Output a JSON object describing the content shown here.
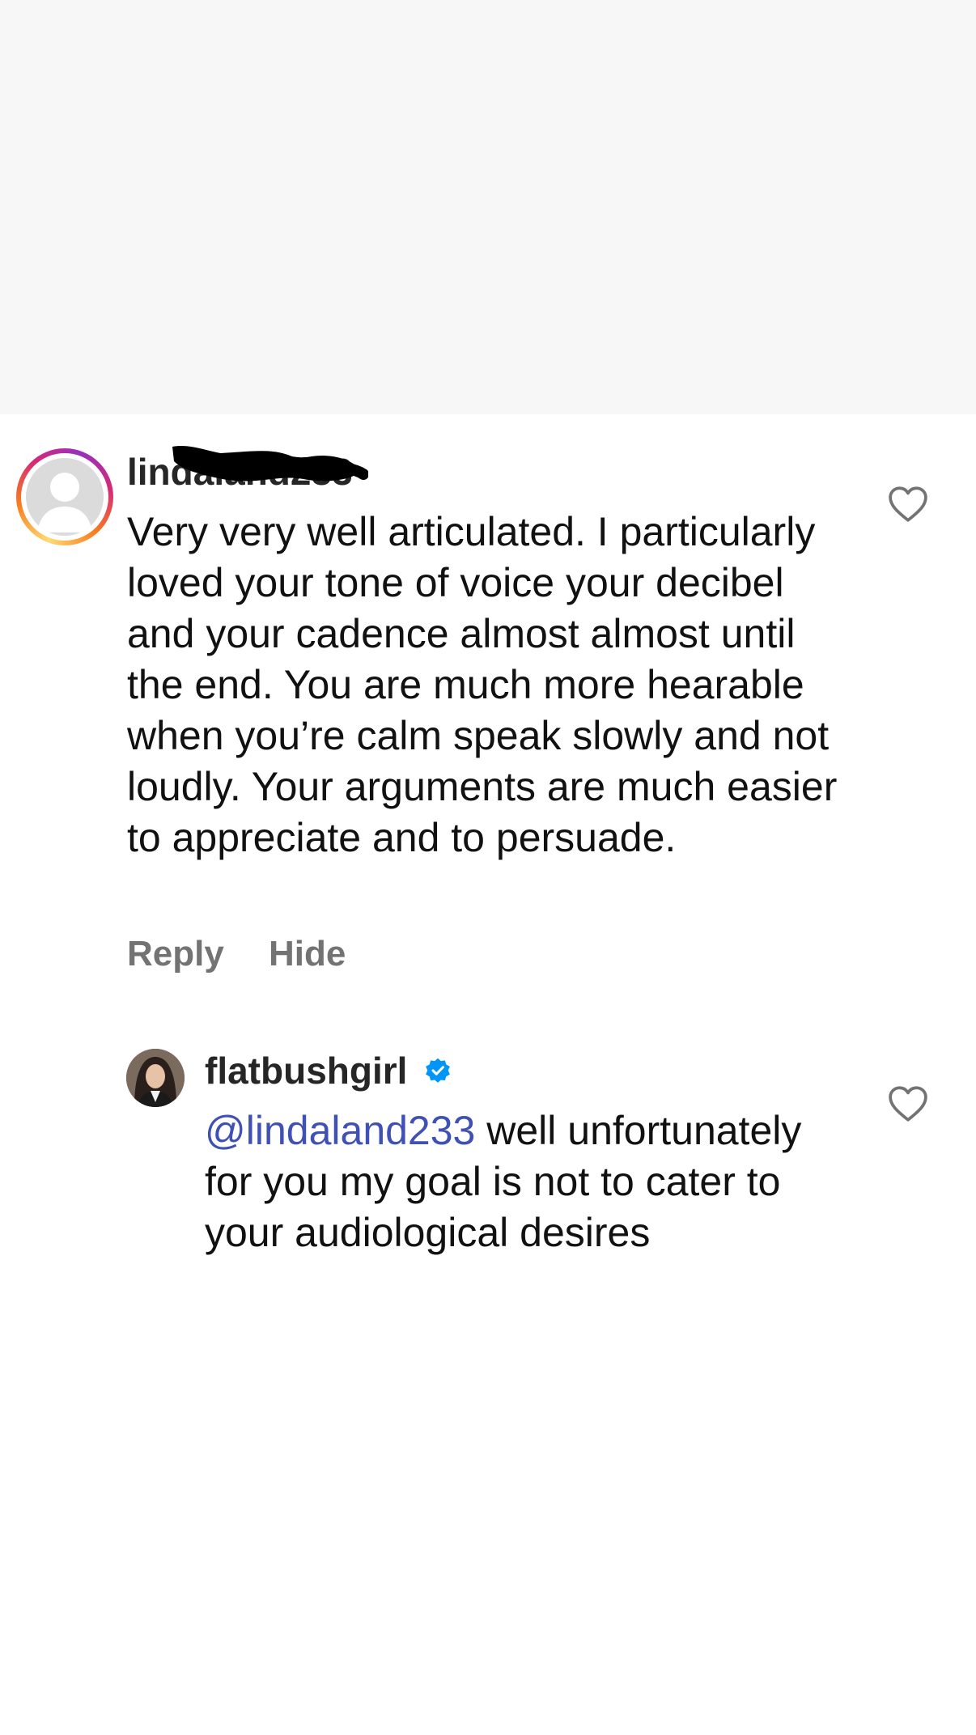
{
  "comment": {
    "username": "lindaland233",
    "text": "Very very well articulated. I particularly loved your tone of voice your decibel and your cadence almost almost until the end. You are much more hearable when you’re calm speak slowly and not loudly. Your arguments are much easier to appreciate and to persuade.",
    "reply_label": "Reply",
    "hide_label": "Hide"
  },
  "reply": {
    "username": "flatbushgirl",
    "mention": "@lindaland233",
    "text": " well unfortunately for you my goal is not to cater to your audiological desires"
  },
  "icons": {
    "like": "heart-outline-icon",
    "verified": "verified-badge-icon",
    "avatar_default": "default-avatar-icon"
  },
  "colors": {
    "verified_blue": "#0095f6",
    "mention_blue": "#3f51b5",
    "action_gray": "#737373",
    "top_area": "#f7f7f8"
  }
}
